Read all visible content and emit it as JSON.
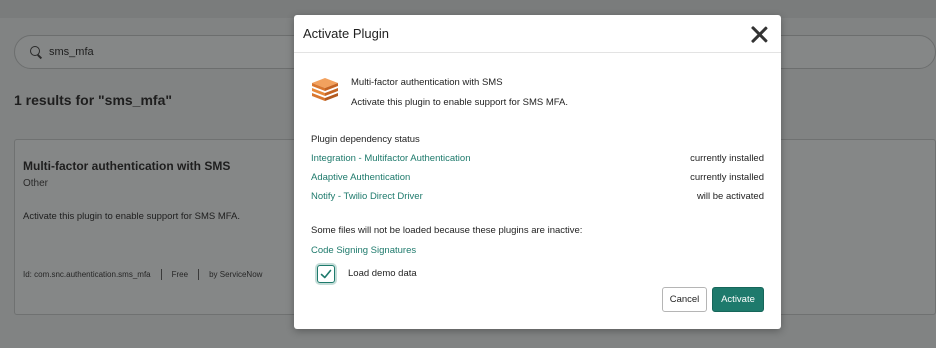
{
  "background": {
    "search": {
      "value": "sms_mfa"
    },
    "results_title": "1 results for \"sms_mfa\"",
    "card": {
      "title": "Multi-factor authentication with SMS",
      "category": "Other",
      "description": "Activate this plugin to enable support for SMS MFA.",
      "meta": {
        "id": "Id: com.snc.authentication.sms_mfa",
        "price": "Free",
        "vendor": "by ServiceNow"
      }
    }
  },
  "modal": {
    "title": "Activate Plugin",
    "close_icon": "close-icon",
    "plugin": {
      "icon": "plugin-stack-icon",
      "name": "Multi-factor authentication with SMS",
      "description": "Activate this plugin to enable support for SMS MFA."
    },
    "dependency_title": "Plugin dependency status",
    "dependencies": [
      {
        "name": "Integration - Multifactor Authentication",
        "status": "currently installed"
      },
      {
        "name": "Adaptive Authentication",
        "status": "currently installed"
      },
      {
        "name": "Notify - Twilio Direct Driver",
        "status": "will be activated"
      }
    ],
    "inactive_note": "Some files will not be loaded because these plugins are inactive:",
    "inactive_plugins": [
      "Code Signing Signatures"
    ],
    "demo_data": {
      "label": "Load demo data",
      "checked": true
    },
    "buttons": {
      "cancel": "Cancel",
      "activate": "Activate"
    }
  },
  "colors": {
    "accent": "#1e7a6c",
    "overlay": "#818383",
    "logo_orange": "#e8893a"
  }
}
